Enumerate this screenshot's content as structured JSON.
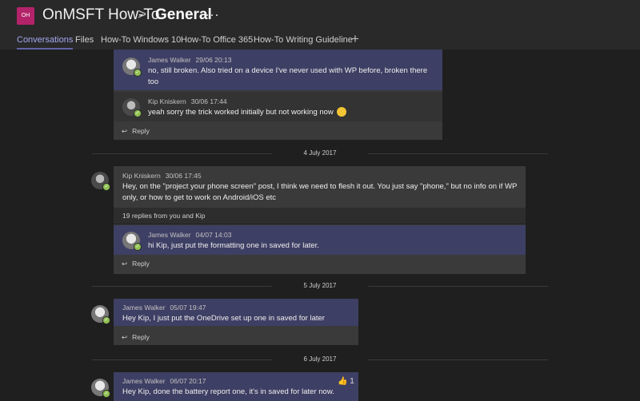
{
  "header": {
    "team_initials": "OH",
    "team_name": "OnMSFT How-To",
    "separator": ">",
    "channel": "General",
    "more": "···"
  },
  "tabs": [
    "Conversations",
    "Files",
    "How-To Windows 10",
    "How-To Office 365",
    "How-To Writing Guideline"
  ],
  "add_tab": "+",
  "thread1": {
    "reply1": {
      "author": "James Walker",
      "time": "29/06 20:13",
      "text": "no, still broken. Also tried on a device I've never used with WP before, broken there too"
    },
    "reply2": {
      "author": "Kip Kniskern",
      "time": "30/06 17:44",
      "text": "yeah sorry the trick worked initially but not working now"
    },
    "reply_label": "Reply"
  },
  "date1": "4 July 2017",
  "thread2": {
    "root": {
      "author": "Kip Kniskern",
      "time": "30/06 17:45",
      "text": "Hey, on the \"project your phone screen\" post, I think we need  to flesh it out. You just say \"phone,\" but no info on if WP only, or how to get to work on Android/iOS etc"
    },
    "summary": "19 replies from you and Kip",
    "reply1": {
      "author": "James Walker",
      "time": "04/07 14:03",
      "text": "hi Kip, just put the formatting one in saved for later."
    },
    "reply_label": "Reply"
  },
  "date2": "5 July 2017",
  "thread3": {
    "root": {
      "author": "James Walker",
      "time": "05/07 19:47",
      "text": "Hey Kip, I just put the OneDrive set up one in saved for later"
    },
    "reply_label": "Reply"
  },
  "date3": "6 July 2017",
  "thread4": {
    "root": {
      "author": "James Walker",
      "time": "06/07 20:17",
      "text": "Hey Kip, done the battery report one, it's in saved for later now.",
      "likes": "1"
    }
  },
  "colors": {
    "accent": "#6264a7",
    "team_avatar": "#b4236a",
    "presence": "#92c353"
  }
}
